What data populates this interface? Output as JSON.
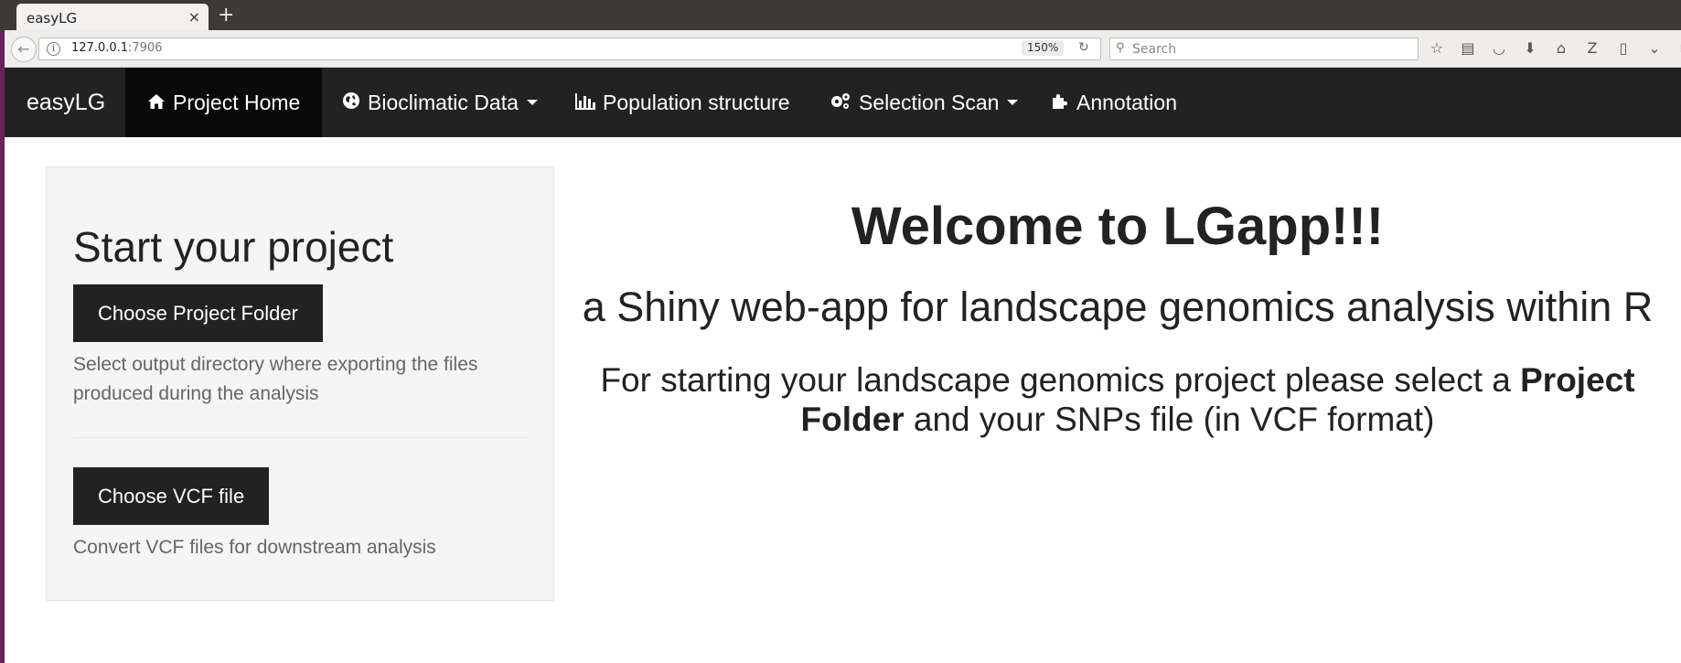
{
  "browser": {
    "tab_title": "easyLG",
    "tab_close": "×",
    "new_tab": "+",
    "url_host": "127.0.0.1",
    "url_port": ":7906",
    "zoom": "150%",
    "search_placeholder": "Search"
  },
  "nav": {
    "brand": "easyLG",
    "items": [
      {
        "label": "Project Home",
        "icon": "home-icon",
        "active": true
      },
      {
        "label": "Bioclimatic Data",
        "icon": "globe-icon",
        "dropdown": true
      },
      {
        "label": "Population structure",
        "icon": "bar-chart-icon"
      },
      {
        "label": "Selection Scan",
        "icon": "gears-icon",
        "dropdown": true
      },
      {
        "label": "Annotation",
        "icon": "puzzle-icon"
      }
    ]
  },
  "sidebar": {
    "title": "Start your project",
    "folder_button": "Choose Project Folder",
    "folder_help": "Select output directory where exporting the files produced during the analysis",
    "vcf_button": "Choose VCF file",
    "vcf_help": "Convert VCF files for downstream analysis"
  },
  "main": {
    "welcome": "Welcome to LGapp!!!",
    "subtitle": "a Shiny web-app for landscape genomics analysis within R",
    "intro_pre": "For starting your landscape genomics project please select a ",
    "intro_bold": "Project Folder",
    "intro_post": " and your SNPs file (in VCF format)"
  }
}
